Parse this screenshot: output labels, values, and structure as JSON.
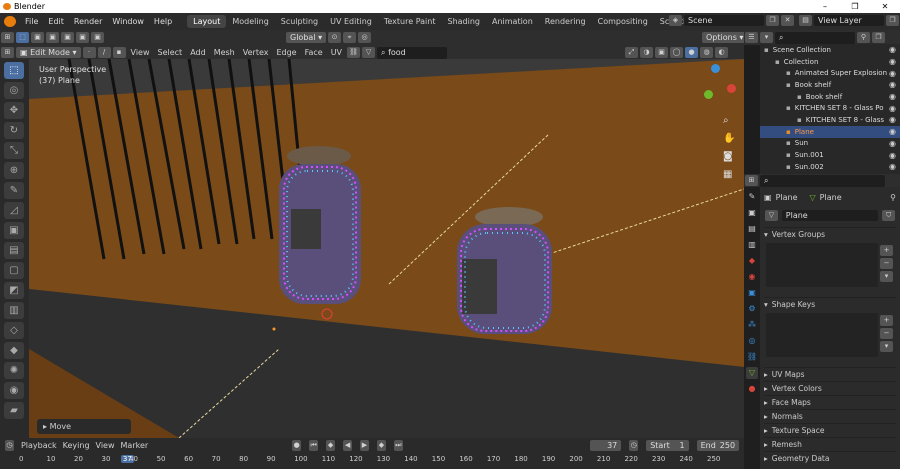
{
  "window": {
    "title": "Blender",
    "minimize": "–",
    "maximize": "❐",
    "close": "✕"
  },
  "menus": [
    "File",
    "Edit",
    "Render",
    "Window",
    "Help"
  ],
  "workspaces": [
    "Layout",
    "Modeling",
    "Sculpting",
    "UV Editing",
    "Texture Paint",
    "Shading",
    "Animation",
    "Rendering",
    "Compositing",
    "Scripting"
  ],
  "active_workspace": "Layout",
  "scene": {
    "name": "Scene",
    "view_layer": "View Layer"
  },
  "header": {
    "mode": "Edit Mode",
    "menus": [
      "View",
      "Select",
      "Add",
      "Mesh",
      "Vertex",
      "Edge",
      "Face",
      "UV"
    ],
    "transform": "Global",
    "search": "food",
    "options": "Options"
  },
  "viewport": {
    "perspective": "User Perspective",
    "object": "(37) Plane",
    "last_op": "Move"
  },
  "outliner": {
    "rows": [
      {
        "label": "Scene Collection",
        "indent": 0,
        "selected": false
      },
      {
        "label": "Collection",
        "indent": 1,
        "selected": false
      },
      {
        "label": "Animated Super Explosion",
        "indent": 2,
        "selected": false
      },
      {
        "label": "Book shelf",
        "indent": 2,
        "selected": false
      },
      {
        "label": "Book shelf",
        "indent": 3,
        "selected": false
      },
      {
        "label": "KITCHEN SET 8 - Glass Po",
        "indent": 2,
        "selected": false
      },
      {
        "label": "KITCHEN SET 8 - Glass",
        "indent": 3,
        "selected": false
      },
      {
        "label": "Plane",
        "indent": 2,
        "selected": true
      },
      {
        "label": "Sun",
        "indent": 2,
        "selected": false
      },
      {
        "label": "Sun.001",
        "indent": 2,
        "selected": false
      },
      {
        "label": "Sun.002",
        "indent": 2,
        "selected": false
      }
    ]
  },
  "properties": {
    "object": "Plane",
    "mesh": "Plane",
    "data_name": "Plane",
    "panels_open": [
      "Vertex Groups",
      "Shape Keys"
    ],
    "panels_closed": [
      "UV Maps",
      "Vertex Colors",
      "Face Maps",
      "Normals",
      "Texture Space",
      "Remesh",
      "Geometry Data"
    ]
  },
  "timeline": {
    "menus": [
      "Playback",
      "Keying",
      "View",
      "Marker"
    ],
    "current_frame": "37",
    "start_label": "Start",
    "start": "1",
    "end_label": "End",
    "end": "250",
    "ticks": [
      "0",
      "10",
      "20",
      "30",
      "37",
      "40",
      "50",
      "60",
      "70",
      "80",
      "90",
      "100",
      "110",
      "120",
      "130",
      "140",
      "150",
      "160",
      "170",
      "180",
      "190",
      "200",
      "210",
      "220",
      "230",
      "240",
      "250"
    ]
  },
  "colors": {
    "accent": "#4a6fa0",
    "floor": "#7a4a18",
    "selected_row": "#334d80"
  }
}
